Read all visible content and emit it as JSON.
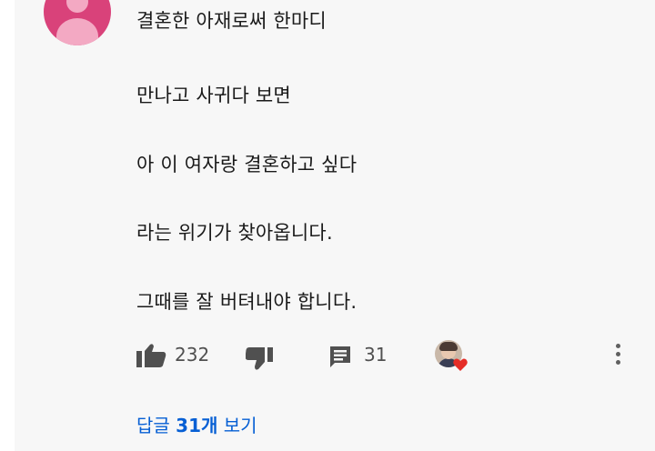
{
  "comment": {
    "lines": [
      "결혼한 아재로써 한마디",
      "만나고 사귀다 보면",
      "아 이 여자랑 결혼하고 싶다",
      "라는 위기가 찾아옵니다.",
      "그때를 잘 버텨내야 합니다."
    ]
  },
  "actions": {
    "like_icon": "thumbs-up-icon",
    "like_count": "232",
    "dislike_icon": "thumbs-down-icon",
    "reply_icon": "comment-icon",
    "reply_count": "31",
    "creator_heart_icon": "heart-icon",
    "more_icon": "more-vertical-icon"
  },
  "replies": {
    "prefix": "답글 ",
    "count": "31개",
    "suffix": " 보기"
  },
  "colors": {
    "link": "#065fd4",
    "heart": "#e52d27",
    "avatar": "#d9427a"
  }
}
